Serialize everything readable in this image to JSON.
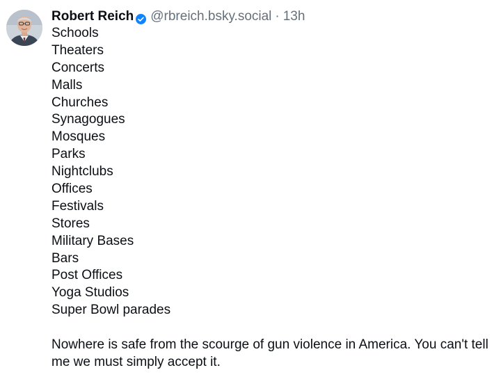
{
  "author": {
    "display_name": "Robert Reich",
    "handle": "@rbreich.bsky.social",
    "verified_icon": "verified-badge-icon",
    "avatar_icon": "avatar-photo"
  },
  "post": {
    "separator": "·",
    "time_ago": "13h",
    "places": [
      "Schools",
      "Theaters",
      "Concerts",
      "Malls",
      "Churches",
      "Synagogues",
      "Mosques",
      "Parks",
      "Nightclubs",
      "Offices",
      "Festivals",
      "Stores",
      "Military Bases",
      "Bars",
      "Post Offices",
      "Yoga Studios",
      "Super Bowl parades"
    ],
    "closing_text": "Nowhere is safe from the scourge of gun violence in America. You can't tell me we must simply accept it."
  },
  "colors": {
    "text": "#0b0f14",
    "muted": "#66707a",
    "verified": "#1083fe",
    "background": "#ffffff"
  }
}
